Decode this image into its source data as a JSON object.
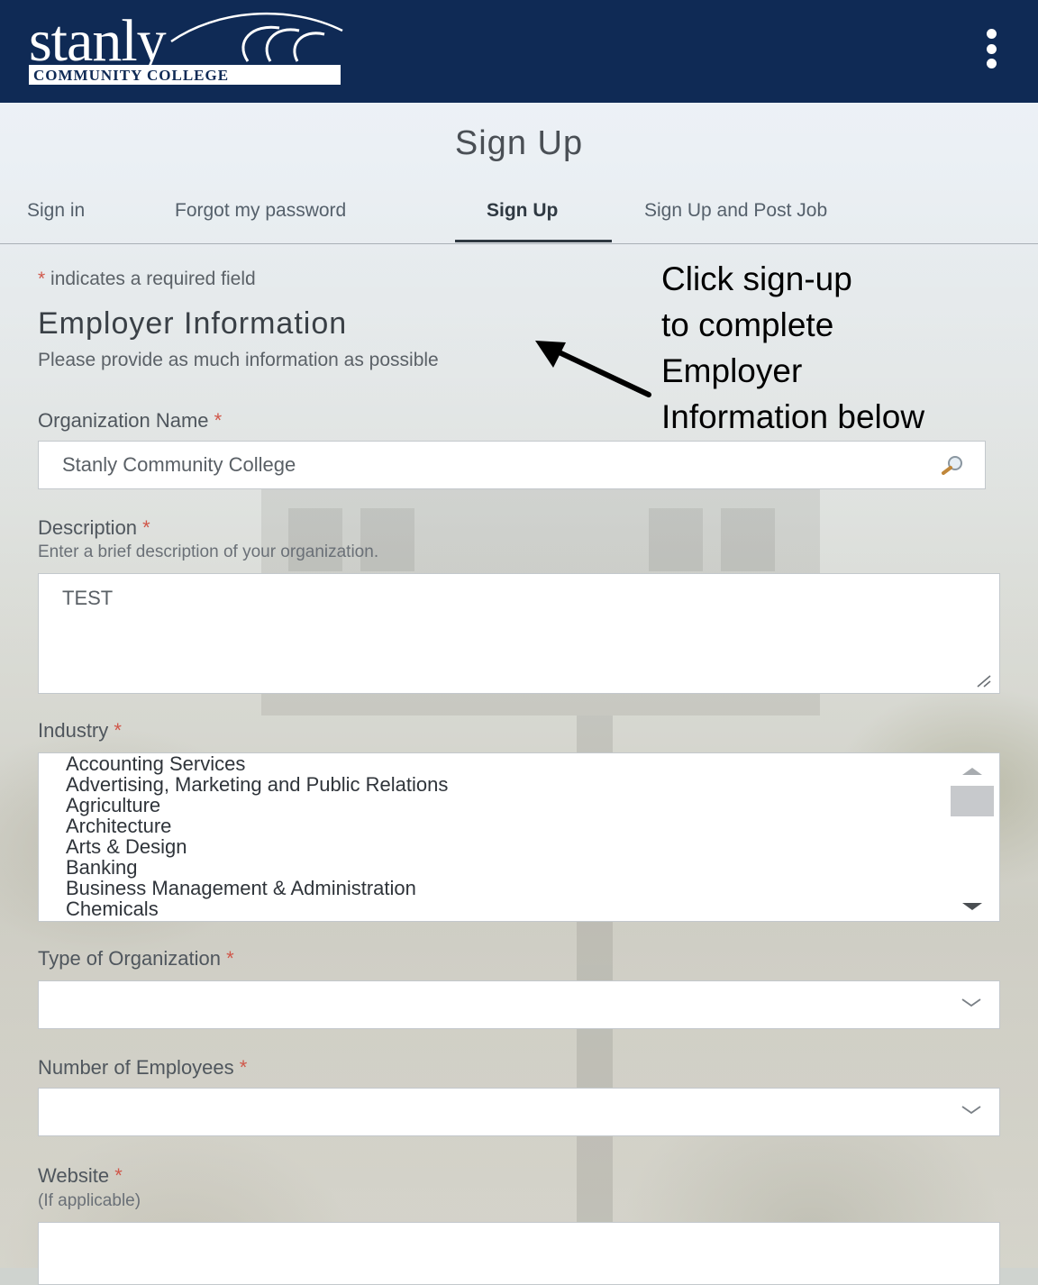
{
  "header": {
    "logo_word": "stanly",
    "logo_sub": "COMMUNITY COLLEGE",
    "menu_icon": "kebab-menu-icon"
  },
  "page": {
    "title": "Sign Up"
  },
  "tabs": [
    {
      "label": "Sign in"
    },
    {
      "label": "Forgot my password"
    },
    {
      "label": "Sign Up",
      "active": true
    },
    {
      "label": "Sign Up and Post Job"
    }
  ],
  "form": {
    "required_note_star": "*",
    "required_note": " indicates a required field",
    "section_title": "Employer Information",
    "section_sub": "Please provide as much information as possible",
    "required_star": "*",
    "org_name": {
      "label": "Organization Name",
      "value": "Stanly Community College",
      "icon": "search-icon"
    },
    "description": {
      "label": "Description",
      "hint": "Enter a brief description of your organization.",
      "value": "TEST"
    },
    "industry": {
      "label": "Industry",
      "options": [
        "Accounting Services",
        "Advertising, Marketing and Public Relations",
        "Agriculture",
        "Architecture",
        "Arts & Design",
        "Banking",
        "Business Management & Administration",
        "Chemicals"
      ]
    },
    "org_type": {
      "label": "Type of Organization",
      "value": ""
    },
    "employees": {
      "label": "Number of Employees",
      "value": ""
    },
    "website": {
      "label": "Website",
      "hint": "(If applicable)",
      "value": ""
    }
  },
  "annotation": {
    "lines": [
      "Click sign-up",
      "to complete",
      "Employer",
      "Information below"
    ]
  },
  "colors": {
    "header_bg": "#0f2a55",
    "required_star": "#d0574a",
    "active_tab": "#2f3942"
  }
}
